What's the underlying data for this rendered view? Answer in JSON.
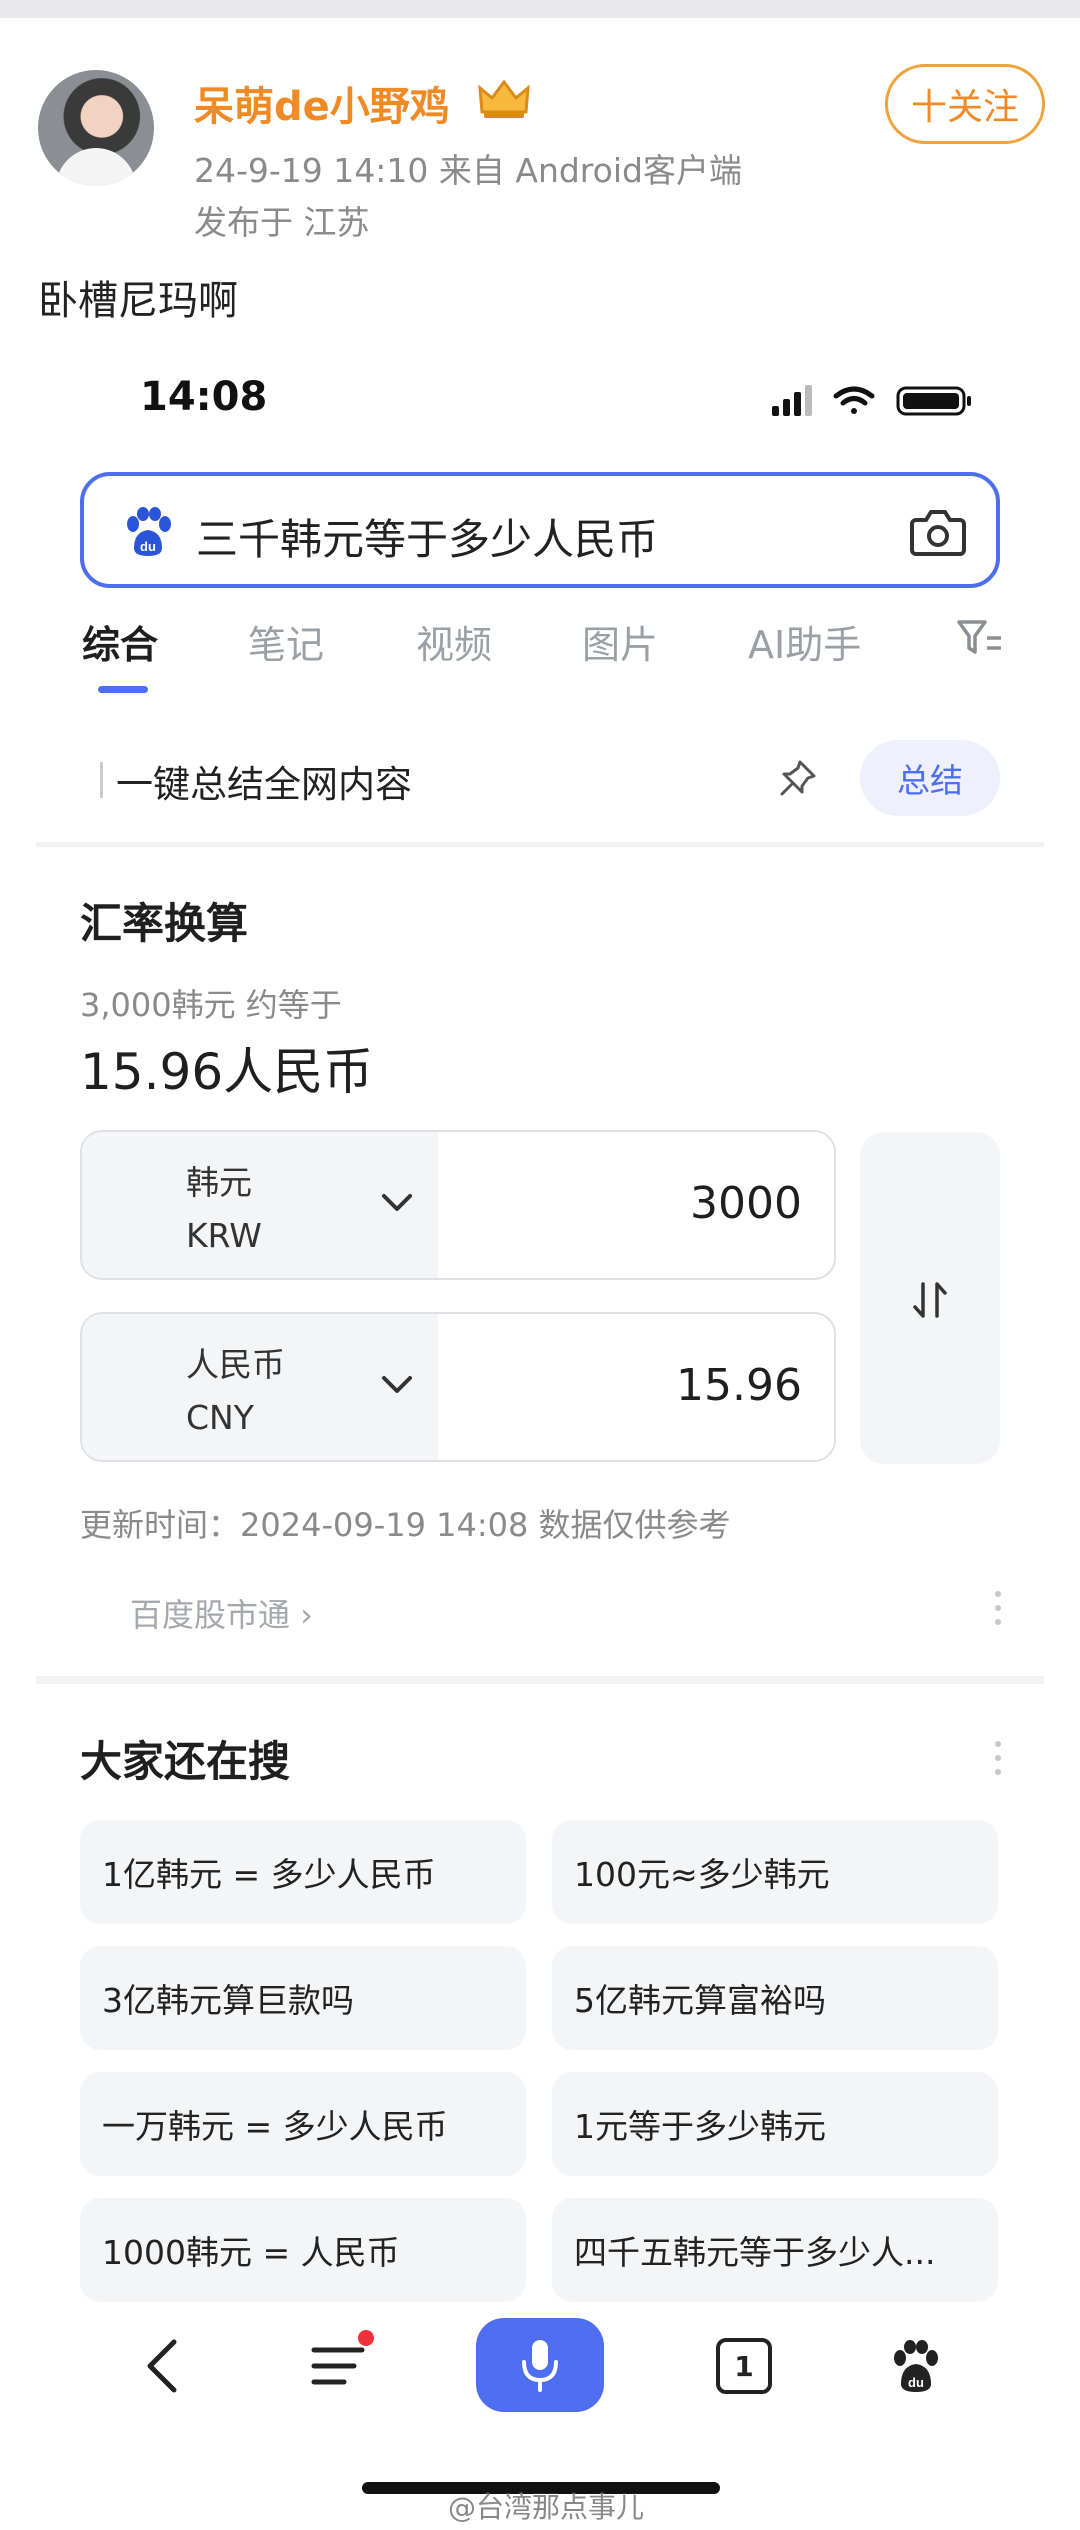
{
  "post": {
    "username": "呆萌de小野鸡",
    "timestamp_source": "24-9-19 14:10  来自 Android客户端",
    "location": "发布于 江苏",
    "follow_label": "十关注",
    "text": "卧槽尼玛啊"
  },
  "phone_status": {
    "time": "14:08"
  },
  "search": {
    "query": "三千韩元等于多少人民币"
  },
  "tabs": [
    {
      "label": "综合"
    },
    {
      "label": "笔记"
    },
    {
      "label": "视频"
    },
    {
      "label": "图片"
    },
    {
      "label": "AI助手"
    }
  ],
  "summary_bar": {
    "text": "一键总结全网内容",
    "button": "总结"
  },
  "exchange": {
    "title": "汇率换算",
    "subtitle": "3,000韩元 约等于",
    "result": "15.96人民币",
    "from": {
      "name": "韩元",
      "code": "KRW",
      "amount": "3000"
    },
    "to": {
      "name": "人民币",
      "code": "CNY",
      "amount": "15.96"
    },
    "update_time": "更新时间：2024-09-19 14:08 数据仅供参考",
    "source": "百度股市通 ›"
  },
  "related": {
    "title": "大家还在搜",
    "items": [
      "1亿韩元 = 多少人民币",
      "100元≈多少韩元",
      "3亿韩元算巨款吗",
      "5亿韩元算富裕吗",
      "一万韩元 = 多少人民币",
      "1元等于多少韩元",
      "1000韩元 = 人民币",
      "四千五韩元等于多少人..."
    ]
  },
  "bottom_nav": {
    "tab_count": "1"
  },
  "watermark": "@台湾那点事儿",
  "colors": {
    "brand_blue": "#4e6ef2",
    "weibo_orange": "#f08a24"
  }
}
